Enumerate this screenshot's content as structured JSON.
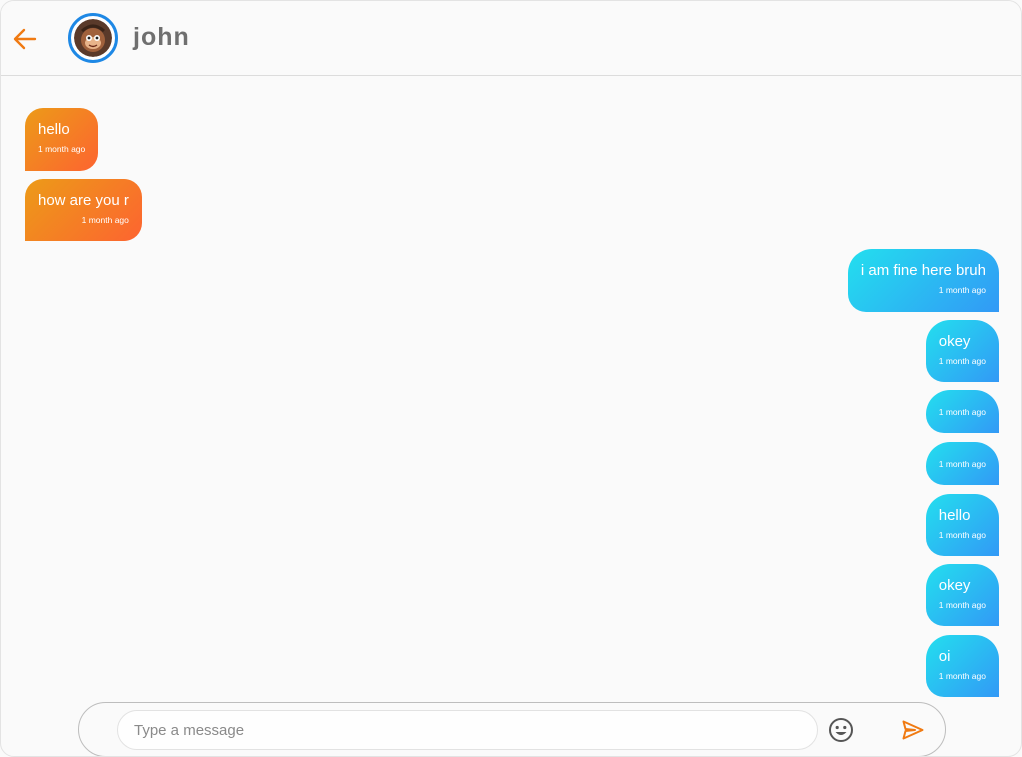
{
  "header": {
    "back_icon": "arrow-left-icon",
    "contact_name": "john",
    "accent_color": "#f07a12",
    "avatar_ring_color": "#1e88e5"
  },
  "messages": [
    {
      "side": "received",
      "text": "hello",
      "time": "1 month ago"
    },
    {
      "side": "received",
      "text": "how are you r",
      "time": "1 month ago"
    },
    {
      "side": "sent",
      "text": "i am fine here bruh",
      "time": "1 month ago"
    },
    {
      "side": "sent",
      "text": "okey",
      "time": "1 month ago"
    },
    {
      "side": "sent",
      "text": "",
      "time": "1 month ago"
    },
    {
      "side": "sent",
      "text": "",
      "time": "1 month ago"
    },
    {
      "side": "sent",
      "text": "hello",
      "time": "1 month ago"
    },
    {
      "side": "sent",
      "text": "okey",
      "time": "1 month ago"
    },
    {
      "side": "sent",
      "text": "oi",
      "time": "1 month ago"
    }
  ],
  "composer": {
    "placeholder": "Type a message",
    "value": "",
    "emoji_icon": "smiley-icon",
    "send_icon": "send-icon"
  },
  "colors": {
    "received_gradient": [
      "#ec9b18",
      "#fd6430"
    ],
    "sent_gradient": [
      "#23dfee",
      "#3299f6"
    ]
  }
}
